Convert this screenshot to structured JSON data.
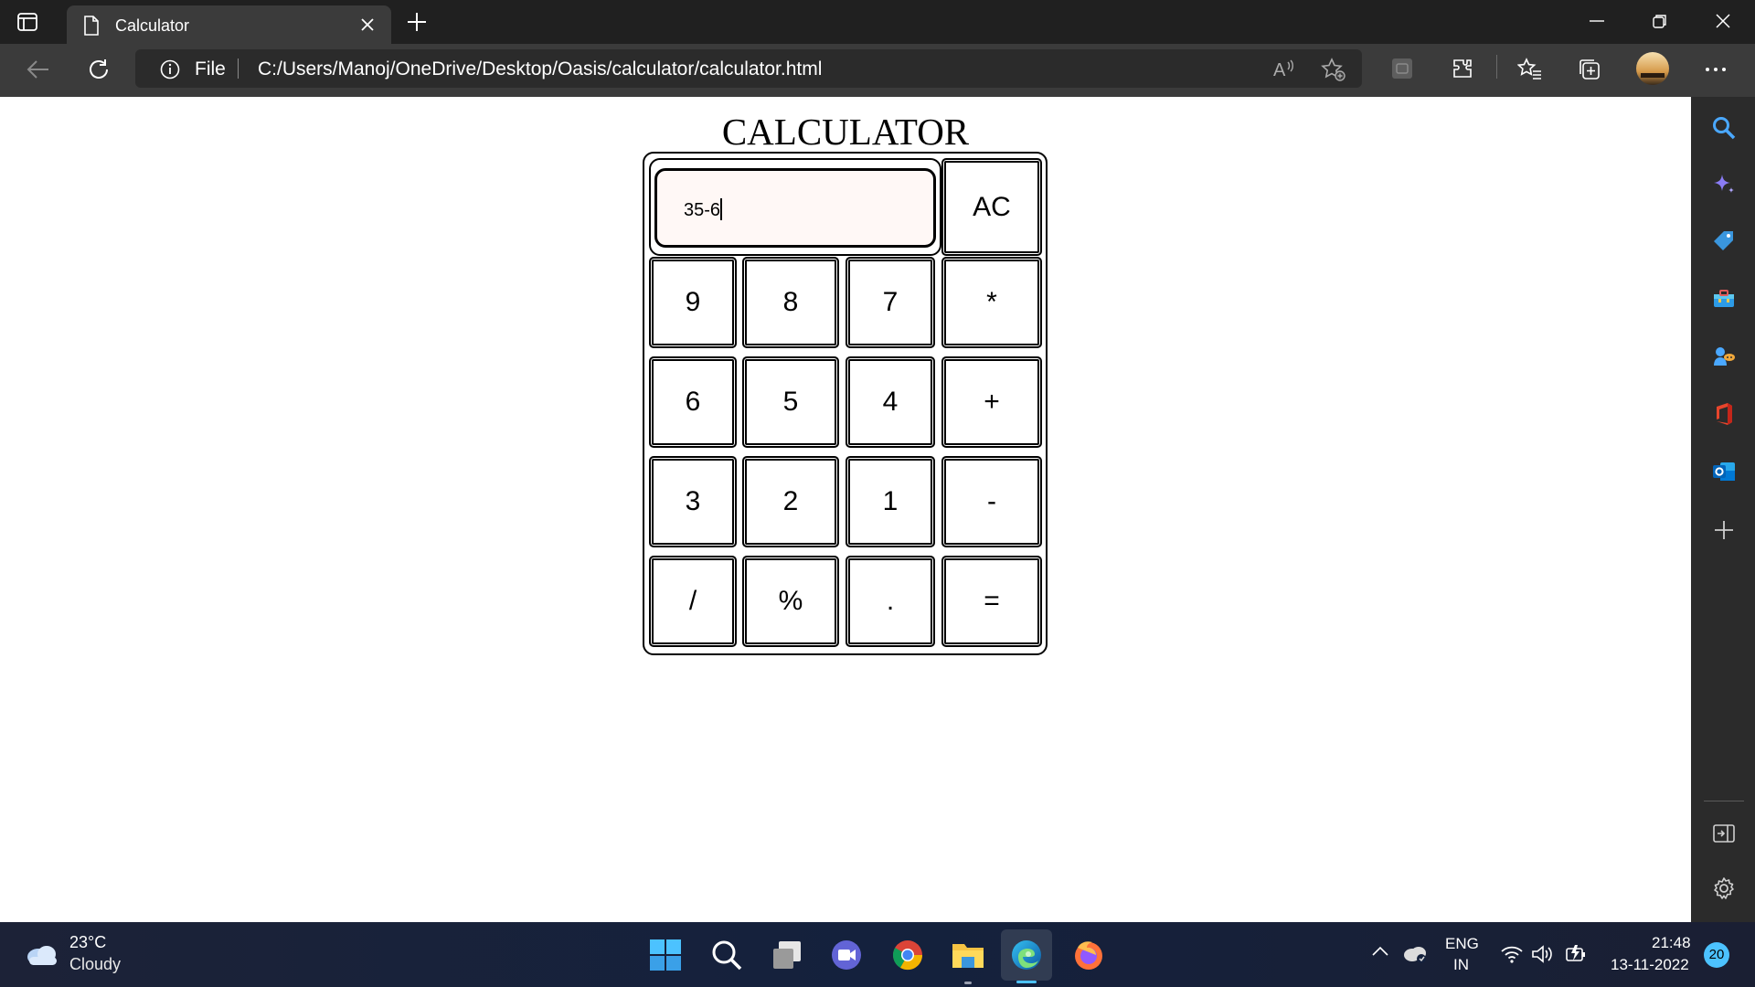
{
  "browser": {
    "tab_title": "Calculator",
    "address_scheme": "File",
    "address_url": "C:/Users/Manoj/OneDrive/Desktop/Oasis/calculator/calculator.html"
  },
  "page": {
    "title": "CALCULATOR",
    "display_value": "35-6",
    "keys": {
      "clear": "AC",
      "row1": [
        "9",
        "8",
        "7",
        "*"
      ],
      "row2": [
        "6",
        "5",
        "4",
        "+"
      ],
      "row3": [
        "3",
        "2",
        "1",
        "-"
      ],
      "row4": [
        "/",
        "%",
        ".",
        "="
      ]
    }
  },
  "taskbar": {
    "weather_temp": "23°C",
    "weather_desc": "Cloudy",
    "lang_line1": "ENG",
    "lang_line2": "IN",
    "time": "21:48",
    "date": "13-11-2022",
    "notification_count": "20"
  },
  "colors": {
    "titlebar": "#202020",
    "toolbar": "#3b3b3b",
    "display_bg": "#fff8f6",
    "taskbar": "#14213d",
    "notification": "#4cc2ff"
  }
}
